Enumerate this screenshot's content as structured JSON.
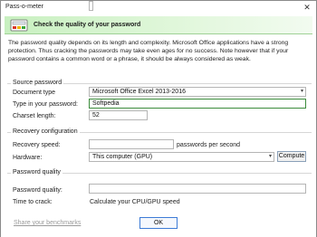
{
  "window": {
    "title": "Pass-o-meter",
    "close_glyph": "✕"
  },
  "banner": {
    "title": "Check the quality of your password",
    "icon": "password-meter-icon"
  },
  "intro": "The password quality depends on its length and complexity. Microsoft Office applications have a strong protection. Thus cracking the passwords may take even ages for no success. Note however that if your password contains a common word or a phrase, it should be always considered as weak.",
  "source": {
    "title": "Source password",
    "document_type_label": "Document type",
    "document_type_value": "Microsoft Office Excel 2013-2016",
    "password_label": "Type in your password:",
    "password_value": "Softpedia",
    "charset_label": "Charset length:",
    "charset_value": "52"
  },
  "recovery": {
    "title": "Recovery configuration",
    "speed_label": "Recovery speed:",
    "speed_value": "",
    "speed_unit": "passwords per second",
    "hardware_label": "Hardware:",
    "hardware_value": "This computer (GPU)",
    "compute_label": "Compute"
  },
  "quality": {
    "title": "Password quality",
    "quality_label": "Password quality:",
    "quality_value": "",
    "time_label": "Time to crack:",
    "time_value": "Calculate your CPU/GPU speed"
  },
  "footer": {
    "share_link": "Share your benchmarks",
    "ok_label": "OK"
  },
  "colors": {
    "accent_green": "#3c8c3c",
    "banner_green": "#c8f0c0"
  }
}
